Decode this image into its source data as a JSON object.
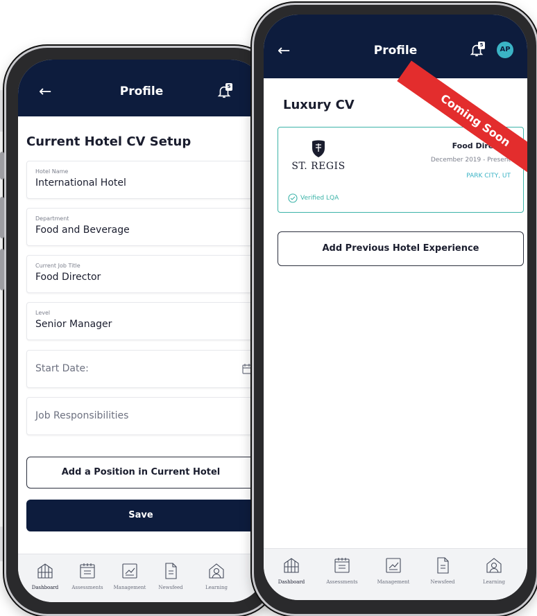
{
  "colors": {
    "navy": "#0d1c3d",
    "teal": "#3bb3c5",
    "ribbon": "#e32d2d"
  },
  "left_screen": {
    "header": {
      "title": "Profile",
      "notification_count": "5",
      "back_icon": "arrow-left-icon",
      "bell_icon": "bell-icon"
    },
    "heading": "Current Hotel CV Setup",
    "fields": {
      "hotel_name": {
        "label": "Hotel Name",
        "value": "International Hotel"
      },
      "department": {
        "label": "Department",
        "value": "Food and Beverage"
      },
      "job_title": {
        "label": "Current Job Title",
        "value": "Food Director"
      },
      "level": {
        "label": "Level",
        "value": "Senior Manager"
      },
      "start_date": {
        "placeholder": "Start Date:",
        "icon": "calendar-icon"
      },
      "responsibilities": {
        "placeholder": "Job Responsibilities"
      }
    },
    "add_position_label": "Add a Position in Current Hotel",
    "save_label": "Save"
  },
  "right_screen": {
    "header": {
      "title": "Profile",
      "notification_count": "5",
      "avatar_initials": "AP",
      "back_icon": "arrow-left-icon",
      "bell_icon": "bell-icon"
    },
    "heading": "Luxury CV",
    "ribbon": "Coming Soon",
    "cv_card": {
      "brand": "ST. REGIS",
      "role": "Food Director",
      "dates": "December 2019 - Present",
      "location": "PARK CITY, UT",
      "verified": "Verified LQA"
    },
    "add_experience_label": "Add Previous Hotel Experience"
  },
  "tabs": [
    {
      "label": "Dashboard",
      "icon": "dashboard-icon"
    },
    {
      "label": "Assessments",
      "icon": "calendar-icon"
    },
    {
      "label": "Management",
      "icon": "chart-icon"
    },
    {
      "label": "Newsfeed",
      "icon": "document-icon"
    },
    {
      "label": "Learning",
      "icon": "person-icon"
    }
  ]
}
